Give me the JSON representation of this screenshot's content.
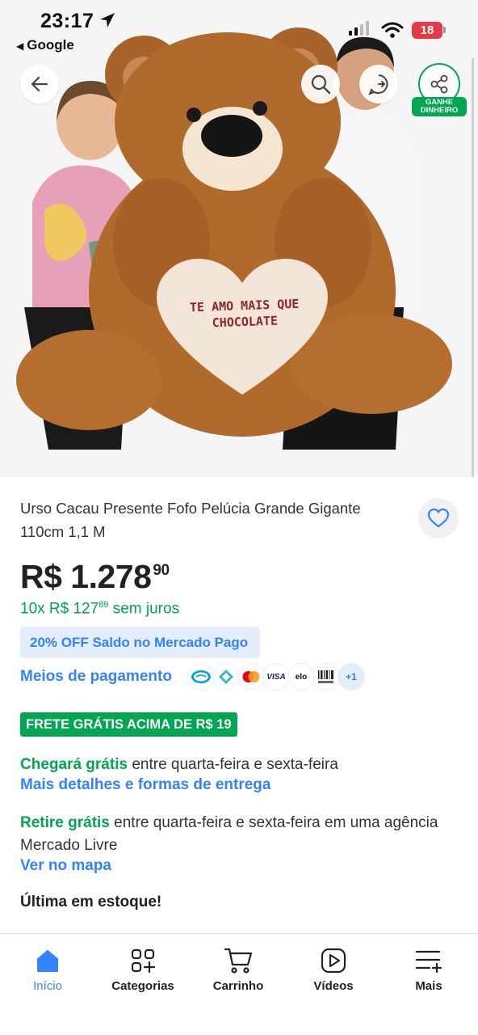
{
  "status_bar": {
    "time": "23:17",
    "back_app": "Google",
    "battery": "18"
  },
  "product_image": {
    "heart_text": "TE AMO MAIS QUE CHOCOLATE"
  },
  "share": {
    "label": "GANHE DINHEIRO"
  },
  "product": {
    "title": "Urso Cacau Presente Fofo Pelúcia Grande Gigante 110cm 1,1 M",
    "price_main": "R$ 1.278",
    "price_cents": "90",
    "installments_prefix": "10x R$ 127",
    "installments_cents": "89",
    "installments_suffix": " sem juros",
    "discount": "20% OFF Saldo no Mercado Pago",
    "payment_link": "Meios de pagamento",
    "payment_more": "+1",
    "payment_icons": [
      "mercado-pago-icon",
      "pix-icon",
      "mastercard-icon",
      "visa-icon",
      "elo-icon",
      "boleto-icon"
    ]
  },
  "shipping": {
    "badge": "FRETE GRÁTIS ACIMA DE R$ 19",
    "arrive_bold": "Chegará grátis",
    "arrive_rest": " entre quarta-feira e sexta-feira",
    "details_link": "Mais detalhes e formas de entrega",
    "pickup_bold": "Retire grátis",
    "pickup_rest": " entre quarta-feira e sexta-feira em uma agência Mercado Livre",
    "map_link": "Ver no mapa",
    "stock": "Última em estoque!"
  },
  "nav": {
    "items": [
      {
        "label": "Início",
        "icon": "home-icon"
      },
      {
        "label": "Categorias",
        "icon": "categories-icon"
      },
      {
        "label": "Carrinho",
        "icon": "cart-icon"
      },
      {
        "label": "Vídeos",
        "icon": "video-icon"
      },
      {
        "label": "Mais",
        "icon": "menu-icon"
      }
    ]
  },
  "colors": {
    "accent_blue": "#3483fa",
    "green": "#00a650",
    "battery_red": "#e63946"
  }
}
